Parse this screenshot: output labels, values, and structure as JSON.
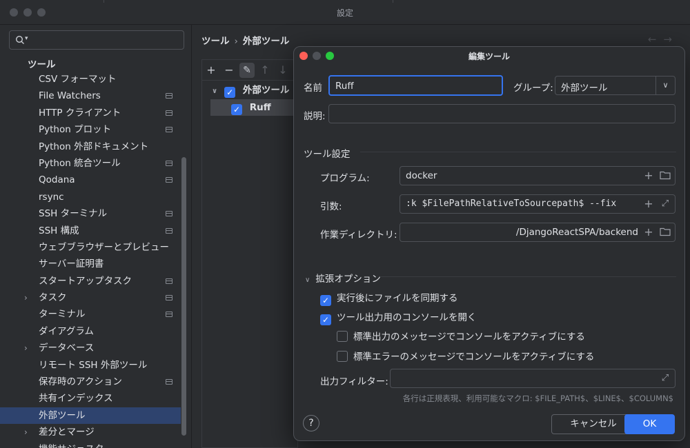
{
  "window": {
    "title": "設定"
  },
  "search": {
    "placeholder": "",
    "value": ""
  },
  "tree": {
    "header": "ツール",
    "items": [
      {
        "label": "CSV フォーマット",
        "chevron": false,
        "badge": false,
        "selected": false
      },
      {
        "label": "File Watchers",
        "chevron": false,
        "badge": true,
        "selected": false
      },
      {
        "label": "HTTP クライアント",
        "chevron": false,
        "badge": true,
        "selected": false
      },
      {
        "label": "Python プロット",
        "chevron": false,
        "badge": true,
        "selected": false
      },
      {
        "label": "Python 外部ドキュメント",
        "chevron": false,
        "badge": false,
        "selected": false
      },
      {
        "label": "Python 統合ツール",
        "chevron": false,
        "badge": true,
        "selected": false
      },
      {
        "label": "Qodana",
        "chevron": false,
        "badge": true,
        "selected": false
      },
      {
        "label": "rsync",
        "chevron": false,
        "badge": false,
        "selected": false
      },
      {
        "label": "SSH ターミナル",
        "chevron": false,
        "badge": true,
        "selected": false
      },
      {
        "label": "SSH 構成",
        "chevron": false,
        "badge": true,
        "selected": false
      },
      {
        "label": "ウェブブラウザーとプレビュー",
        "chevron": false,
        "badge": false,
        "selected": false
      },
      {
        "label": "サーバー証明書",
        "chevron": false,
        "badge": false,
        "selected": false
      },
      {
        "label": "スタートアップタスク",
        "chevron": false,
        "badge": true,
        "selected": false
      },
      {
        "label": "タスク",
        "chevron": true,
        "badge": true,
        "selected": false
      },
      {
        "label": "ターミナル",
        "chevron": false,
        "badge": true,
        "selected": false
      },
      {
        "label": "ダイアグラム",
        "chevron": false,
        "badge": false,
        "selected": false
      },
      {
        "label": "データベース",
        "chevron": true,
        "badge": false,
        "selected": false
      },
      {
        "label": "リモート SSH 外部ツール",
        "chevron": false,
        "badge": false,
        "selected": false
      },
      {
        "label": "保存時のアクション",
        "chevron": false,
        "badge": true,
        "selected": false
      },
      {
        "label": "共有インデックス",
        "chevron": false,
        "badge": false,
        "selected": false
      },
      {
        "label": "外部ツール",
        "chevron": false,
        "badge": false,
        "selected": true
      },
      {
        "label": "差分とマージ",
        "chevron": true,
        "badge": false,
        "selected": false
      },
      {
        "label": "機能サジェスター",
        "chevron": false,
        "badge": false,
        "selected": false
      }
    ]
  },
  "breadcrumb": {
    "parent": "ツール",
    "separator": "›",
    "current": "外部ツール"
  },
  "nav": {
    "back": "←",
    "forward": "→"
  },
  "tools_toolbar": {
    "add": "+",
    "remove": "−",
    "edit": "✎",
    "up": "↑",
    "down": "↓"
  },
  "tools_tree": {
    "group_label": "外部ツール",
    "item_label": "Ruff"
  },
  "dialog": {
    "title": "編集ツール",
    "name_label": "名前",
    "name_value": "Ruff",
    "group_label": "グループ:",
    "group_value": "外部ツール",
    "description_label": "説明:",
    "description_value": "",
    "tool_settings_section": "ツール設定",
    "program_label": "プログラム:",
    "program_value": "docker",
    "args_label": "引数:",
    "args_value": ":k $FilePathRelativeToSourcepath$ --fix",
    "workdir_label": "作業ディレクトリ:",
    "workdir_value": "/DjangoReactSPA/backend",
    "advanced_section": "拡張オプション",
    "options": [
      {
        "label": "実行後にファイルを同期する",
        "checked": true
      },
      {
        "label": "ツール出力用のコンソールを開く",
        "checked": true
      },
      {
        "label": "標準出力のメッセージでコンソールをアクティブにする",
        "checked": false
      },
      {
        "label": "標準エラーのメッセージでコンソールをアクティブにする",
        "checked": false
      }
    ],
    "output_filter_label": "出力フィルター:",
    "output_filter_value": "",
    "hint": "各行は正規表現、利用可能なマクロ: $FILE_PATH$、$LINE$、$COLUMN$",
    "help_label": "?",
    "cancel_label": "キャンセル",
    "ok_label": "OK"
  },
  "colors": {
    "accent": "#3574f0",
    "selection": "#2e436e",
    "background": "#2b2d30"
  }
}
